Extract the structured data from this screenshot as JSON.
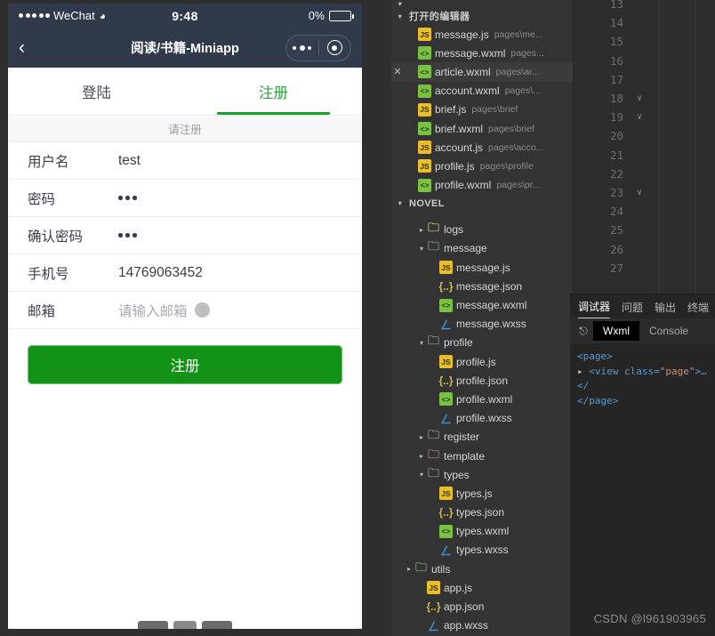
{
  "simulator": {
    "status_bar": {
      "carrier": "WeChat",
      "time": "9:48",
      "battery": "0%"
    },
    "nav_bar": {
      "back": "‹",
      "title": "阅读/书籍-Miniapp"
    },
    "tabs": [
      {
        "label": "登陆",
        "active": false
      },
      {
        "label": "注册",
        "active": true
      }
    ],
    "hint": "请注册",
    "form": {
      "fields": [
        {
          "label": "用户名",
          "value": "test",
          "type": "text"
        },
        {
          "label": "密码",
          "value": "•••",
          "type": "password"
        },
        {
          "label": "确认密码",
          "value": "•••",
          "type": "password"
        },
        {
          "label": "手机号",
          "value": "14769063452",
          "type": "tel"
        },
        {
          "label": "邮箱",
          "value": "",
          "placeholder": "请输入邮箱",
          "type": "email"
        }
      ],
      "submit_label": "注册"
    }
  },
  "ide": {
    "explorer": {
      "section_open_editors": "打开的编辑器",
      "section_project": "NOVEL",
      "open_editors": [
        {
          "name": "message.js",
          "path": "pages\\me...",
          "icon": "js",
          "close": false,
          "selected": false
        },
        {
          "name": "message.wxml",
          "path": "pages...",
          "icon": "wxml",
          "close": false,
          "selected": false
        },
        {
          "name": "article.wxml",
          "path": "pages\\ar...",
          "icon": "wxml",
          "close": true,
          "selected": true
        },
        {
          "name": "account.wxml",
          "path": "pages\\...",
          "icon": "wxml",
          "close": false,
          "selected": false
        },
        {
          "name": "brief.js",
          "path": "pages\\brief",
          "icon": "js",
          "close": false,
          "selected": false
        },
        {
          "name": "brief.wxml",
          "path": "pages\\brief",
          "icon": "wxml",
          "close": false,
          "selected": false
        },
        {
          "name": "account.js",
          "path": "pages\\acco...",
          "icon": "js",
          "close": false,
          "selected": false
        },
        {
          "name": "profile.js",
          "path": "pages\\profile",
          "icon": "js",
          "close": false,
          "selected": false
        },
        {
          "name": "profile.wxml",
          "path": "pages\\pr...",
          "icon": "wxml",
          "close": false,
          "selected": false
        }
      ],
      "tree": [
        {
          "name": "logs",
          "icon": "folder-y",
          "indent": 2,
          "twisty": "▸"
        },
        {
          "name": "message",
          "icon": "folder",
          "indent": 2,
          "twisty": "▾"
        },
        {
          "name": "message.js",
          "icon": "js",
          "indent": 3,
          "twisty": ""
        },
        {
          "name": "message.json",
          "icon": "json",
          "indent": 3,
          "twisty": ""
        },
        {
          "name": "message.wxml",
          "icon": "wxml",
          "indent": 3,
          "twisty": ""
        },
        {
          "name": "message.wxss",
          "icon": "wxss",
          "indent": 3,
          "twisty": ""
        },
        {
          "name": "profile",
          "icon": "folder",
          "indent": 2,
          "twisty": "▾"
        },
        {
          "name": "profile.js",
          "icon": "js",
          "indent": 3,
          "twisty": ""
        },
        {
          "name": "profile.json",
          "icon": "json",
          "indent": 3,
          "twisty": ""
        },
        {
          "name": "profile.wxml",
          "icon": "wxml",
          "indent": 3,
          "twisty": ""
        },
        {
          "name": "profile.wxss",
          "icon": "wxss",
          "indent": 3,
          "twisty": ""
        },
        {
          "name": "register",
          "icon": "folder",
          "indent": 2,
          "twisty": "▸"
        },
        {
          "name": "template",
          "icon": "folder-r",
          "indent": 2,
          "twisty": "▸"
        },
        {
          "name": "types",
          "icon": "folder",
          "indent": 2,
          "twisty": "▾"
        },
        {
          "name": "types.js",
          "icon": "js",
          "indent": 3,
          "twisty": ""
        },
        {
          "name": "types.json",
          "icon": "json",
          "indent": 3,
          "twisty": ""
        },
        {
          "name": "types.wxml",
          "icon": "wxml",
          "indent": 3,
          "twisty": ""
        },
        {
          "name": "types.wxss",
          "icon": "wxss",
          "indent": 3,
          "twisty": ""
        },
        {
          "name": "utils",
          "icon": "folder-g",
          "indent": 1,
          "twisty": "▸"
        },
        {
          "name": "app.js",
          "icon": "js",
          "indent": 2,
          "twisty": ""
        },
        {
          "name": "app.json",
          "icon": "json",
          "indent": 2,
          "twisty": ""
        },
        {
          "name": "app.wxss",
          "icon": "wxss",
          "indent": 2,
          "twisty": ""
        }
      ]
    },
    "editor": {
      "line_numbers": [
        "13",
        "14",
        "15",
        "16",
        "17",
        "18",
        "19",
        "20",
        "21",
        "22",
        "23",
        "24",
        "25",
        "26",
        "27"
      ],
      "folded_lines": [
        "18",
        "19",
        "23"
      ]
    },
    "debug_panel": {
      "tabs": [
        {
          "label": "调试器",
          "active": true
        },
        {
          "label": "问题",
          "active": false
        },
        {
          "label": "输出",
          "active": false
        },
        {
          "label": "终端",
          "active": false
        }
      ],
      "sub_tabs": [
        {
          "label": "Wxml",
          "active": true
        },
        {
          "label": "Console",
          "active": false
        }
      ],
      "inspect_icon": "pointer-icon",
      "code": {
        "line1_open": "<page>",
        "line2_arrow": "▸",
        "line2_a": "<view class=",
        "line2_val": "\"page\"",
        "line2_b": ">…</",
        "line3_close": "</page>"
      }
    }
  },
  "watermark": "CSDN @l961903965"
}
